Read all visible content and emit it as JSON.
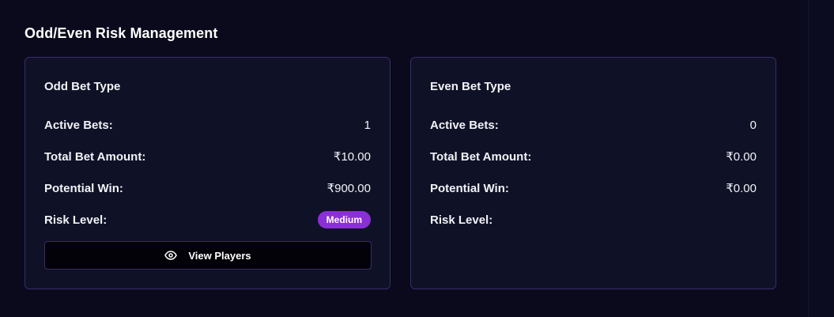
{
  "section": {
    "title": "Odd/Even Risk Management"
  },
  "odd_card": {
    "title": "Odd Bet Type",
    "rows": [
      {
        "label": "Active Bets:",
        "value": "1"
      },
      {
        "label": "Total Bet Amount:",
        "value": "₹10.00"
      },
      {
        "label": "Potential Win:",
        "value": "₹900.00"
      },
      {
        "label": "Risk Level:",
        "value": "Medium"
      }
    ],
    "risk_badge_color": "#8b2fd9",
    "view_players_label": "View Players",
    "view_players_icon": "eye-icon"
  },
  "even_card": {
    "title": "Even Bet Type",
    "rows": [
      {
        "label": "Active Bets:",
        "value": "0"
      },
      {
        "label": "Total Bet Amount:",
        "value": "₹0.00"
      },
      {
        "label": "Potential Win:",
        "value": "₹0.00"
      },
      {
        "label": "Risk Level:",
        "value": ""
      }
    ]
  },
  "colors": {
    "background": "#0a0a1c",
    "card_background": "#0f1226",
    "card_border": "#3a2a6a",
    "accent": "#8b2fd9"
  }
}
